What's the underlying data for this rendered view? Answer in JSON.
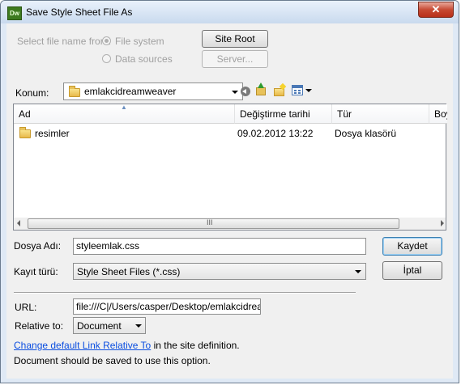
{
  "window": {
    "app_icon_text": "Dw",
    "title": "Save Style Sheet File As",
    "close_glyph": "✕"
  },
  "select_from": {
    "label": "Select file name from:",
    "option_file_system": "File system",
    "option_data_sources": "Data sources",
    "site_root_label": "Site Root",
    "server_label": "Server..."
  },
  "location": {
    "label": "Konum:",
    "current_folder": "emlakcidreamweaver"
  },
  "file_list": {
    "columns": [
      "Ad",
      "Değiştirme tarihi",
      "Tür",
      "Boy"
    ],
    "rows": [
      {
        "name": "resimler",
        "modified": "09.02.2012 13:22",
        "type": "Dosya klasörü"
      }
    ],
    "scroll_grip": "III"
  },
  "file_name": {
    "label": "Dosya Adı:",
    "value": "styleemlak.css"
  },
  "file_type": {
    "label": "Kayıt türü:",
    "value": "Style Sheet Files (*.css)"
  },
  "actions": {
    "save_label": "Kaydet",
    "cancel_label": "İptal"
  },
  "url": {
    "label": "URL:",
    "value": "file:///C|/Users/casper/Desktop/emlakcidreamweaver"
  },
  "relative_to": {
    "label": "Relative to:",
    "value": "Document"
  },
  "notes": {
    "link_text": "Change default Link Relative To",
    "link_suffix": " in the site definition.",
    "save_note": "Document should be saved to use this option."
  }
}
